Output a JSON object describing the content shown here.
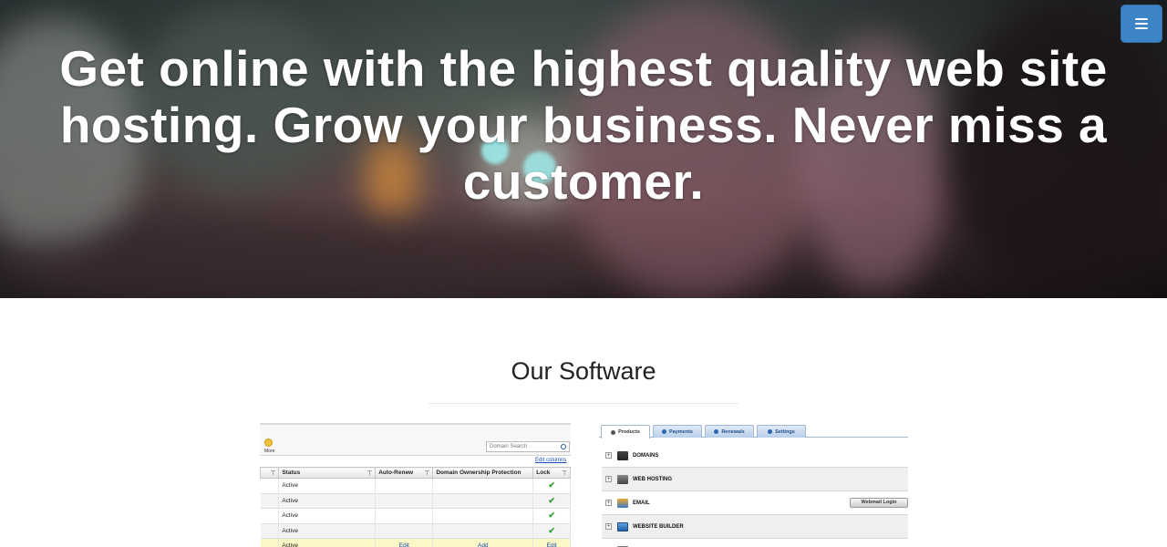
{
  "hero": {
    "title": "Get online with the highest quality web site hosting. Grow your business. Never miss a customer.",
    "menu_icon": "hamburger-icon",
    "accent_color": "#3d85c6"
  },
  "software": {
    "title": "Our Software",
    "domain_manager": {
      "more_label": "More",
      "search_placeholder": "Domain Search",
      "edit_columns": "Edit columns",
      "columns": [
        "Status",
        "Auto-Renew",
        "Domain Ownership Protection",
        "Lock"
      ],
      "rows": [
        {
          "status": "Active",
          "auto_renew": "",
          "protection": "",
          "lock": "✔"
        },
        {
          "status": "Active",
          "auto_renew": "",
          "protection": "",
          "lock": "✔"
        },
        {
          "status": "Active",
          "auto_renew": "",
          "protection": "",
          "lock": "✔"
        },
        {
          "status": "Active",
          "auto_renew": "",
          "protection": "",
          "lock": "✔"
        },
        {
          "status": "Active",
          "auto_renew": "Edit",
          "protection": "Add",
          "lock": "Edit"
        }
      ]
    },
    "product_panel": {
      "tabs": [
        "Products",
        "Payments",
        "Renewals",
        "Settings"
      ],
      "products": [
        "DOMAINS",
        "WEB HOSTING",
        "EMAIL",
        "WEBSITE BUILDER"
      ],
      "webmail_button": "Webmail Login"
    }
  }
}
